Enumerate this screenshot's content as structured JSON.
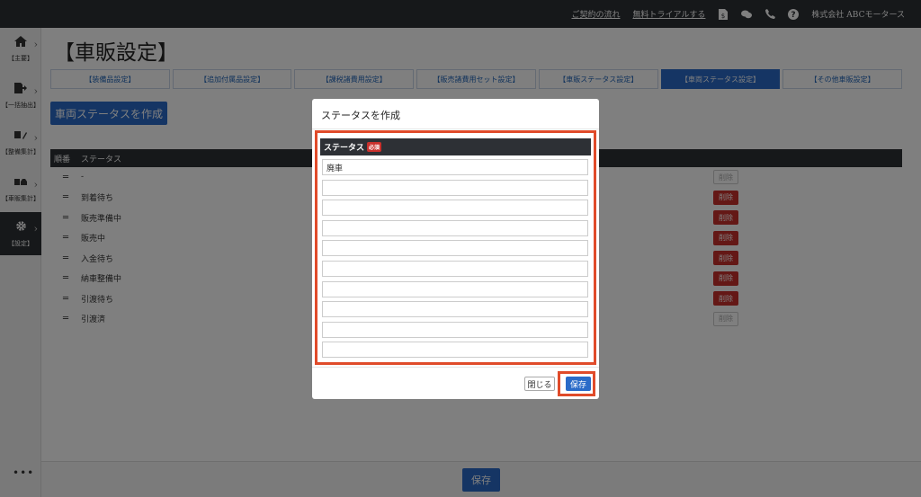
{
  "topbar": {
    "link_contract": "ご契約の流れ",
    "link_trial": "無料トライアルする",
    "icons": [
      "document-dollar-icon",
      "chat-icon",
      "phone-icon",
      "help-icon"
    ],
    "company": "株式会社 ABCモータース"
  },
  "sidebar": {
    "items": [
      {
        "icon": "home-icon",
        "label": "【主要】"
      },
      {
        "icon": "export-icon",
        "label": "【一括抽出】"
      },
      {
        "icon": "tools-icon",
        "label": "【整備集計】"
      },
      {
        "icon": "car-icon",
        "label": "【車販集計】"
      },
      {
        "icon": "gear-icon",
        "label": "【設定】"
      }
    ],
    "more": "•••"
  },
  "main": {
    "title": "【車販設定】",
    "tabs": [
      {
        "label": "【装備品設定】",
        "active": false
      },
      {
        "label": "【追加付属品設定】",
        "active": false
      },
      {
        "label": "【課税諸費用設定】",
        "active": false
      },
      {
        "label": "【販売諸費用セット設定】",
        "active": false
      },
      {
        "label": "【車販ステータス設定】",
        "active": false
      },
      {
        "label": "【車両ステータス設定】",
        "active": true
      },
      {
        "label": "【その他車販設定】",
        "active": false
      }
    ],
    "create_button": "車両ステータスを作成",
    "table": {
      "col_order": "順番",
      "col_status": "ステータス",
      "delete_label": "削除",
      "rows": [
        {
          "name": "-",
          "deletable": false
        },
        {
          "name": "到着待ち",
          "deletable": true
        },
        {
          "name": "販売準備中",
          "deletable": true
        },
        {
          "name": "販売中",
          "deletable": true
        },
        {
          "name": "入金待ち",
          "deletable": true
        },
        {
          "name": "納車整備中",
          "deletable": true
        },
        {
          "name": "引渡待ち",
          "deletable": true
        },
        {
          "name": "引渡済",
          "deletable": false
        }
      ]
    },
    "save_button": "保存"
  },
  "modal": {
    "title": "ステータスを作成",
    "field_label": "ステータス",
    "required_badge": "必須",
    "inputs": [
      "廃車",
      "",
      "",
      "",
      "",
      "",
      "",
      "",
      "",
      ""
    ],
    "close_button": "閉じる",
    "save_button": "保存"
  },
  "colors": {
    "primary": "#2a6bc8",
    "danger": "#c9302c",
    "dark": "#2d3035",
    "highlight": "#e04b2a"
  }
}
